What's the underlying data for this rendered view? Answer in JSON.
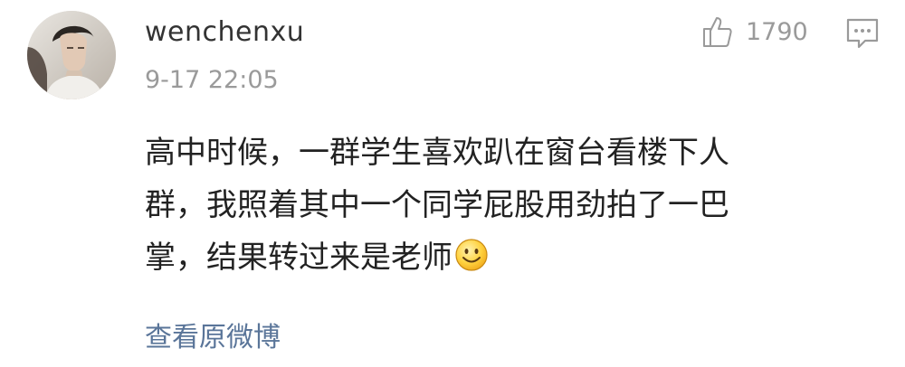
{
  "comment": {
    "username": "wenchenxu",
    "timestamp": "9-17 22:05",
    "like_icon": "thumbs-up-icon",
    "like_count": "1790",
    "reply_icon": "comment-bubble-icon",
    "content_lines": [
      "高中时候，一群学生喜欢趴在窗台看楼下人",
      "群，我照着其中一个同学屁股用劲拍了一巴",
      "掌，结果转过来是老师"
    ],
    "emoji": "smiley-face-icon",
    "view_link": "查看原微博"
  },
  "colors": {
    "text": "#222222",
    "secondary": "#9a9a9a",
    "link": "#5a7599"
  }
}
